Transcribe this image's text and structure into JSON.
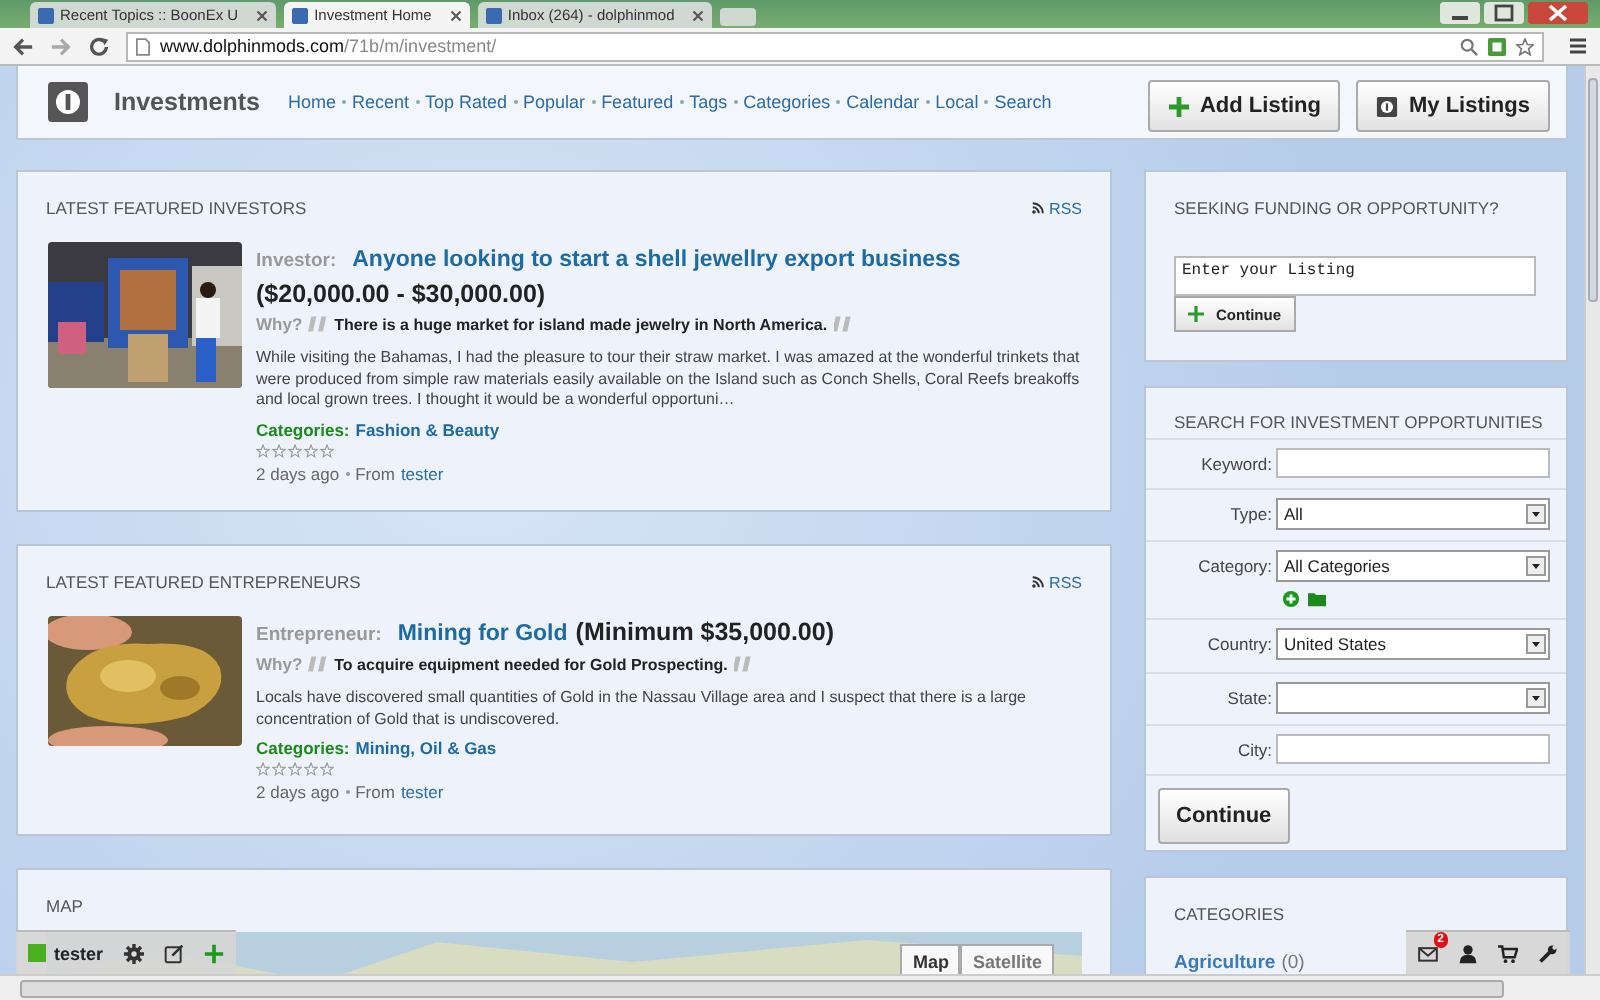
{
  "browser": {
    "tabs": [
      {
        "title": "Recent Topics :: BoonEx U",
        "selected": false
      },
      {
        "title": "Investment Home",
        "selected": true
      },
      {
        "title": "Inbox (264) - dolphinmod",
        "selected": false
      }
    ],
    "address": {
      "host": "www.dolphinmods.com",
      "path": "/71b/m/investment/"
    }
  },
  "header": {
    "title": "Investments",
    "nav": [
      "Home",
      "Recent",
      "Top Rated",
      "Popular",
      "Featured",
      "Tags",
      "Categories",
      "Calendar",
      "Local",
      "Search"
    ],
    "buttons": [
      {
        "label": "Add Listing",
        "kind": "add"
      },
      {
        "label": "My Listings",
        "kind": "mine"
      }
    ]
  },
  "featured": [
    {
      "heading": "LATEST FEATURED INVESTORS",
      "rss": "RSS",
      "role": "Investor:",
      "title": "Anyone looking to start a shell jewellry export business",
      "amount": "($20,000.00 - $30,000.00)",
      "why_label": "Why?",
      "why": "There is a huge market for island made jewelry in North America.",
      "description": "While visiting the Bahamas, I had the pleasure to tour their straw market. I was amazed at the wonderful trinkets that were produced from simple raw materials easily available on the Island such as Conch Shells, Coral Reefs breakoffs and local grown trees. I thought it would be a wonderful opportuni…",
      "categories_label": "Categories:",
      "categories": "Fashion & Beauty",
      "stars": 0,
      "age": "2 days ago",
      "from_label": "From",
      "author": "tester"
    },
    {
      "heading": "LATEST FEATURED ENTREPRENEURS",
      "rss": "RSS",
      "role": "Entrepreneur:",
      "title": "Mining for Gold",
      "amount": "(Minimum $35,000.00)",
      "why_label": "Why?",
      "why": "To acquire equipment needed for Gold Prospecting.",
      "description": "Locals have discovered small quantities of Gold in the Nassau Village area and I suspect that there is a large concentration of Gold that is undiscovered.",
      "categories_label": "Categories:",
      "categories": "Mining, Oil & Gas",
      "stars": 0,
      "age": "2 days ago",
      "from_label": "From",
      "author": "tester"
    }
  ],
  "map": {
    "heading": "MAP",
    "buttons": [
      {
        "label": "Map",
        "selected": true
      },
      {
        "label": "Satellite",
        "selected": false
      }
    ]
  },
  "seeking": {
    "heading": "SEEKING FUNDING OR OPPORTUNITY?",
    "value": "Enter your Listing",
    "button": "Continue"
  },
  "search": {
    "heading": "SEARCH FOR INVESTMENT OPPORTUNITIES",
    "fields": [
      {
        "label": "Keyword:",
        "kind": "text"
      },
      {
        "label": "Type:",
        "kind": "select",
        "value": "All"
      },
      {
        "label": "Category:",
        "kind": "select_tools",
        "value": "All Categories"
      },
      {
        "label": "Country:",
        "kind": "select",
        "value": "United States"
      },
      {
        "label": "State:",
        "kind": "select"
      },
      {
        "label": "City:",
        "kind": "text"
      }
    ],
    "button": "Continue"
  },
  "categories": {
    "heading": "CATEGORIES",
    "items": [
      {
        "name": "Agriculture",
        "count": "(0)"
      }
    ]
  },
  "toolbar": {
    "user": "tester",
    "mail_count": "2"
  }
}
